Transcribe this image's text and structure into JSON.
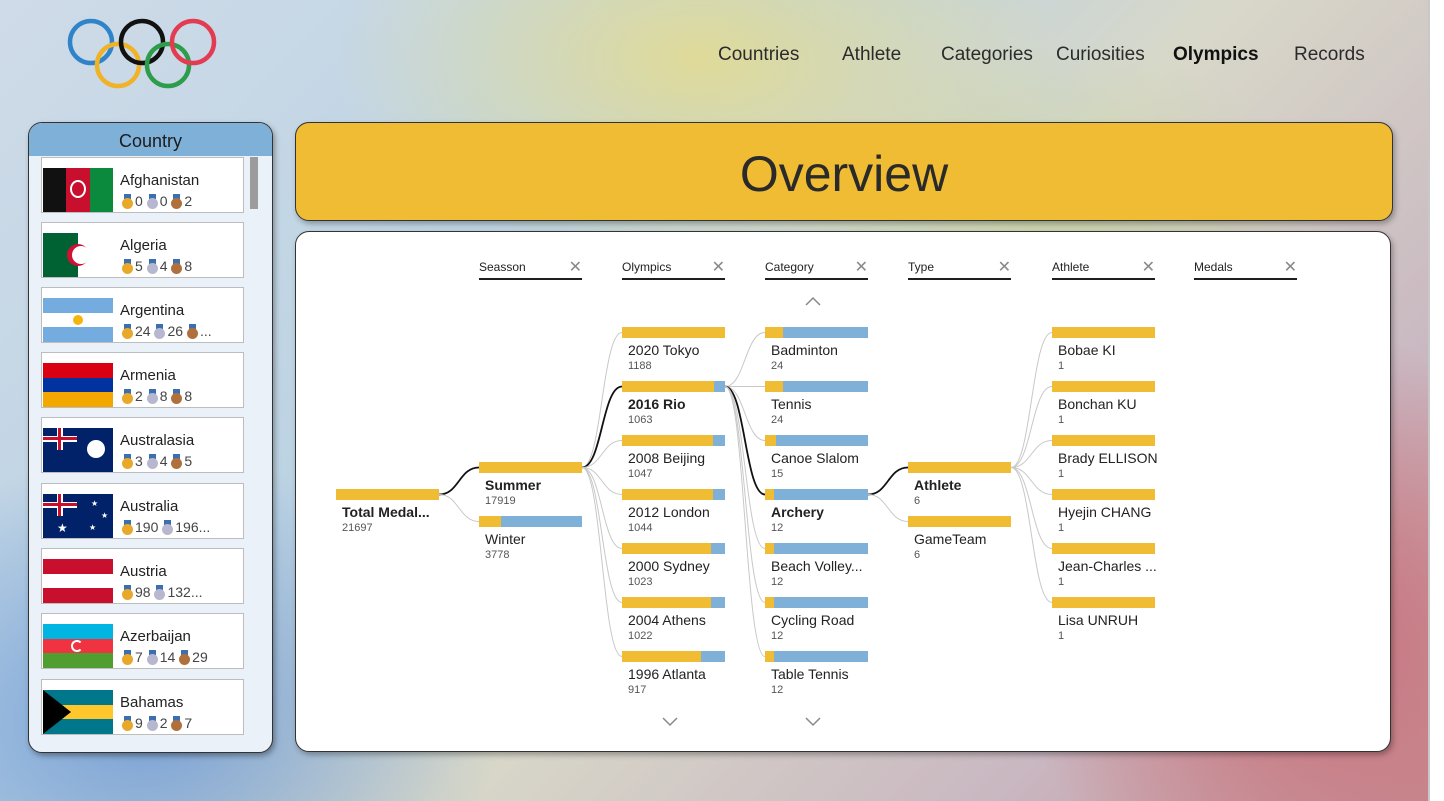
{
  "nav": {
    "items": [
      "Countries",
      "Athlete",
      "Categories",
      "Curiosities",
      "Olympics",
      "Records"
    ],
    "active": "Olympics"
  },
  "country_panel": {
    "header": "Country",
    "countries": [
      {
        "name": "Afghanistan",
        "medals": "0 0 2",
        "gold": "0",
        "silver": "0",
        "bronze": "2"
      },
      {
        "name": "Algeria",
        "gold": "5",
        "silver": "4",
        "bronze": "8"
      },
      {
        "name": "Argentina",
        "gold": "24",
        "silver": "26",
        "bronze": "..."
      },
      {
        "name": "Armenia",
        "gold": "2",
        "silver": "8",
        "bronze": "8"
      },
      {
        "name": "Australasia",
        "gold": "3",
        "silver": "4",
        "bronze": "5"
      },
      {
        "name": "Australia",
        "gold": "190",
        "silver": "196...",
        "bronze": ""
      },
      {
        "name": "Austria",
        "gold": "98",
        "silver": "132...",
        "bronze": ""
      },
      {
        "name": "Azerbaijan",
        "gold": "7",
        "silver": "14",
        "bronze": "29"
      },
      {
        "name": "Bahamas",
        "gold": "9",
        "silver": "2",
        "bronze": "7"
      }
    ]
  },
  "banner": {
    "title": "Overview"
  },
  "decomposition": {
    "columns": [
      "Seasson",
      "Olympics",
      "Category",
      "Type",
      "Athlete",
      "Medals"
    ],
    "root": {
      "label": "Total Medal...",
      "value": "21697",
      "fill": 1.0
    },
    "season": [
      {
        "label": "Summer",
        "value": "17919",
        "fill": 1.0,
        "selected": true
      },
      {
        "label": "Winter",
        "value": "3778",
        "fill": 0.21,
        "selected": false
      }
    ],
    "olympics": [
      {
        "label": "2020 Tokyo",
        "value": "1188",
        "fill": 1.0,
        "selected": false
      },
      {
        "label": "2016 Rio",
        "value": "1063",
        "fill": 0.89,
        "selected": true
      },
      {
        "label": "2008 Beijing",
        "value": "1047",
        "fill": 0.88,
        "selected": false
      },
      {
        "label": "2012 London",
        "value": "1044",
        "fill": 0.88,
        "selected": false
      },
      {
        "label": "2000 Sydney",
        "value": "1023",
        "fill": 0.86,
        "selected": false
      },
      {
        "label": "2004 Athens",
        "value": "1022",
        "fill": 0.86,
        "selected": false
      },
      {
        "label": "1996 Atlanta",
        "value": "917",
        "fill": 0.77,
        "selected": false
      }
    ],
    "category": [
      {
        "label": "Badminton",
        "value": "24",
        "fill": 0.17,
        "selected": false
      },
      {
        "label": "Tennis",
        "value": "24",
        "fill": 0.17,
        "selected": false
      },
      {
        "label": "Canoe Slalom",
        "value": "15",
        "fill": 0.11,
        "selected": false
      },
      {
        "label": "Archery",
        "value": "12",
        "fill": 0.09,
        "selected": true
      },
      {
        "label": "Beach Volley...",
        "value": "12",
        "fill": 0.09,
        "selected": false
      },
      {
        "label": "Cycling Road",
        "value": "12",
        "fill": 0.09,
        "selected": false
      },
      {
        "label": "Table Tennis",
        "value": "12",
        "fill": 0.09,
        "selected": false
      }
    ],
    "type": [
      {
        "label": "Athlete",
        "value": "6",
        "fill": 1.0,
        "selected": true
      },
      {
        "label": "GameTeam",
        "value": "6",
        "fill": 1.0,
        "selected": false
      }
    ],
    "athlete": [
      {
        "label": "Bobae KI",
        "value": "1",
        "fill": 1.0
      },
      {
        "label": "Bonchan KU",
        "value": "1",
        "fill": 1.0
      },
      {
        "label": "Brady ELLISON",
        "value": "1",
        "fill": 1.0
      },
      {
        "label": "Hyejin CHANG",
        "value": "1",
        "fill": 1.0
      },
      {
        "label": "Jean-Charles ...",
        "value": "1",
        "fill": 1.0
      },
      {
        "label": "Lisa UNRUH",
        "value": "1",
        "fill": 1.0
      }
    ]
  },
  "colors": {
    "gold": "#f0bc33",
    "blue": "#7fb0d8",
    "panel_border": "#333333"
  }
}
